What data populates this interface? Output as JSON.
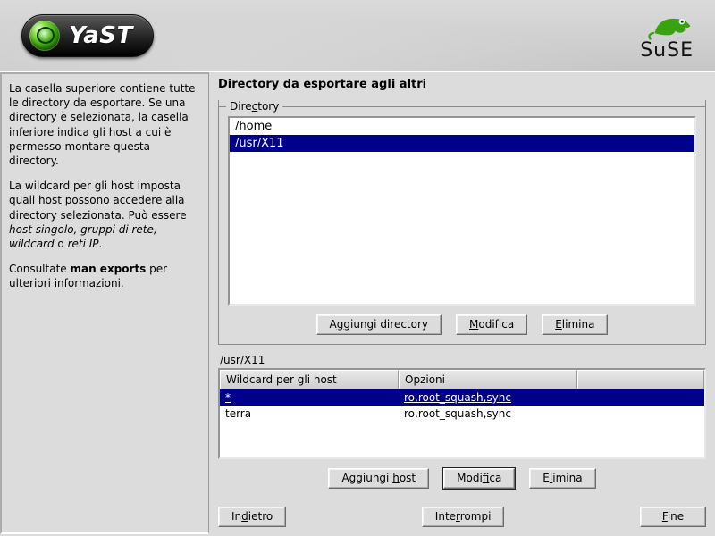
{
  "header": {
    "app_name": "YaST",
    "brand": "SuSE"
  },
  "help": {
    "p1": "La casella superiore contiene tutte le directory da esportare. Se una directory è selezionata, la casella inferiore indica gli host a cui è permesso montare questa directory.",
    "p2_a": "La wildcard per gli host imposta quali host possono accedere alla directory selezionata. Può essere ",
    "p2_em": "host singolo, gruppi di rete, wildcard",
    "p2_b": " o ",
    "p2_em2": "reti IP",
    "p2_c": ".",
    "p3_a": "Consultate ",
    "p3_b": "man exports",
    "p3_c": " per ulteriori informazioni."
  },
  "main": {
    "title": "Directory da esportare agli altri",
    "group_label_pre": "Dire",
    "group_label_ul": "c",
    "group_label_post": "tory",
    "directories": [
      {
        "path": "/home",
        "selected": false
      },
      {
        "path": "/usr/X11",
        "selected": true
      }
    ],
    "dir_buttons": {
      "add_pre": "A",
      "add_ul": "g",
      "add_post": "giungi directory",
      "edit_pre": "",
      "edit_ul": "M",
      "edit_post": "odifica",
      "del_pre": "",
      "del_ul": "E",
      "del_post": "limina"
    },
    "hosts_caption": "/usr/X11",
    "hosts_headers": {
      "c1": "Wildcard per gli host",
      "c2": "Opzioni"
    },
    "hosts": [
      {
        "wildcard": "*",
        "options": "ro,root_squash,sync",
        "selected": true
      },
      {
        "wildcard": "terra",
        "options": "ro,root_squash,sync",
        "selected": false
      }
    ],
    "host_buttons": {
      "add_pre": "Aggiungi ",
      "add_ul": "h",
      "add_post": "ost",
      "edit_pre": "Modi",
      "edit_ul": "f",
      "edit_post": "ica",
      "del_pre": "E",
      "del_ul": "l",
      "del_post": "imina"
    },
    "nav": {
      "back_pre": "In",
      "back_ul": "d",
      "back_post": "ietro",
      "abort_pre": "Inte",
      "abort_ul": "r",
      "abort_post": "rompi",
      "finish_pre": "",
      "finish_ul": "F",
      "finish_post": "ine"
    }
  }
}
